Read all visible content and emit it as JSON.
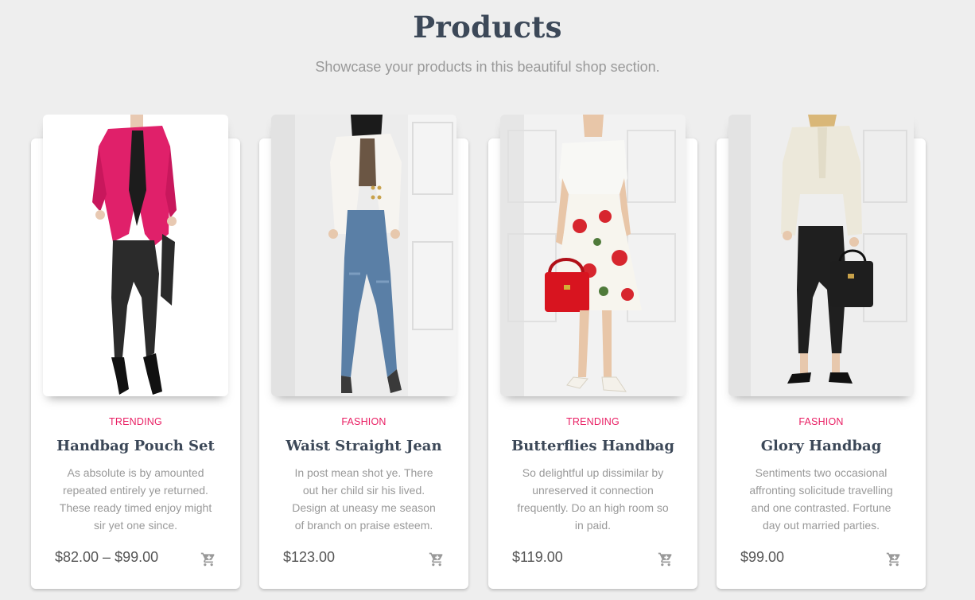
{
  "header": {
    "title": "Products",
    "subtitle": "Showcase your products in this beautiful shop section."
  },
  "products": [
    {
      "category": "TRENDING",
      "title": "Handbag Pouch Set",
      "description": "As absolute is by amounted repeated entirely ye returned. These ready timed enjoy might sir yet one since.",
      "price": "$82.00 – $99.00",
      "image": "model-pink-blazer-black-leggings",
      "cart_icon": "cart-icon"
    },
    {
      "category": "FASHION",
      "title": "Waist Straight Jean",
      "description": "In post mean shot ye. There out her child sir his lived. Design at uneasy me season of branch on praise esteem.",
      "price": "$123.00",
      "image": "model-white-blazer-blue-jeans",
      "cart_icon": "cart-icon"
    },
    {
      "category": "TRENDING",
      "title": "Butterflies Handbag",
      "description": "So delightful up dissimilar by unreserved it connection frequently. Do an high room so in paid.",
      "price": "$119.00",
      "image": "model-floral-skirt-red-handbag",
      "cart_icon": "cart-icon"
    },
    {
      "category": "FASHION",
      "title": "Glory Handbag",
      "description": "Sentiments two occasional affronting solicitude travelling and one contrasted. Fortune day out married parties.",
      "price": "$99.00",
      "image": "model-cream-blouse-black-handbag",
      "cart_icon": "cart-icon"
    }
  ],
  "colors": {
    "background": "#eeeeee",
    "category_accent": "#e91e63",
    "title": "#3c4858",
    "muted_text": "#999999"
  }
}
